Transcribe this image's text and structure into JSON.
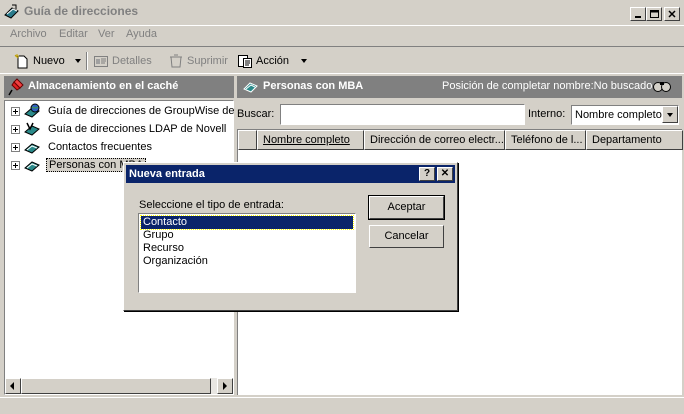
{
  "window": {
    "title": "Guía de direcciones"
  },
  "menu": [
    {
      "label": "Archivo"
    },
    {
      "label": "Editar"
    },
    {
      "label": "Ver"
    },
    {
      "label": "Ayuda"
    }
  ],
  "toolbar": {
    "new_label": "Nuevo",
    "details_label": "Detalles",
    "delete_label": "Suprimir",
    "action_label": "Acción"
  },
  "left_panel": {
    "title": "Almacenamiento en el caché",
    "items": [
      {
        "label": "Guía de direcciones de GroupWise de"
      },
      {
        "label": "Guía de direcciones LDAP de Novell"
      },
      {
        "label": "Contactos frecuentes"
      },
      {
        "label": "Personas con MBA"
      }
    ]
  },
  "right_panel": {
    "title": "Personas con MBA",
    "status": "Posición de completar nombre:No buscado",
    "search_label": "Buscar:",
    "search_value": "",
    "interno_label": "Interno:",
    "interno_value": "Nombre completo",
    "columns": [
      {
        "label": "Nombre completo"
      },
      {
        "label": "Dirección de correo electr..."
      },
      {
        "label": "Teléfono de l..."
      },
      {
        "label": "Departamento"
      }
    ]
  },
  "dialog": {
    "title": "Nueva entrada",
    "help_glyph": "?",
    "close_glyph": "✕",
    "prompt": "Seleccione el tipo de entrada:",
    "options": [
      {
        "label": "Contacto",
        "selected": true
      },
      {
        "label": "Grupo"
      },
      {
        "label": "Recurso"
      },
      {
        "label": "Organización"
      }
    ],
    "accept_label": "Aceptar",
    "cancel_label": "Cancelar"
  },
  "colors": {
    "face": "#d4d0c8",
    "header_bg": "#808080",
    "selection": "#0a246a"
  }
}
